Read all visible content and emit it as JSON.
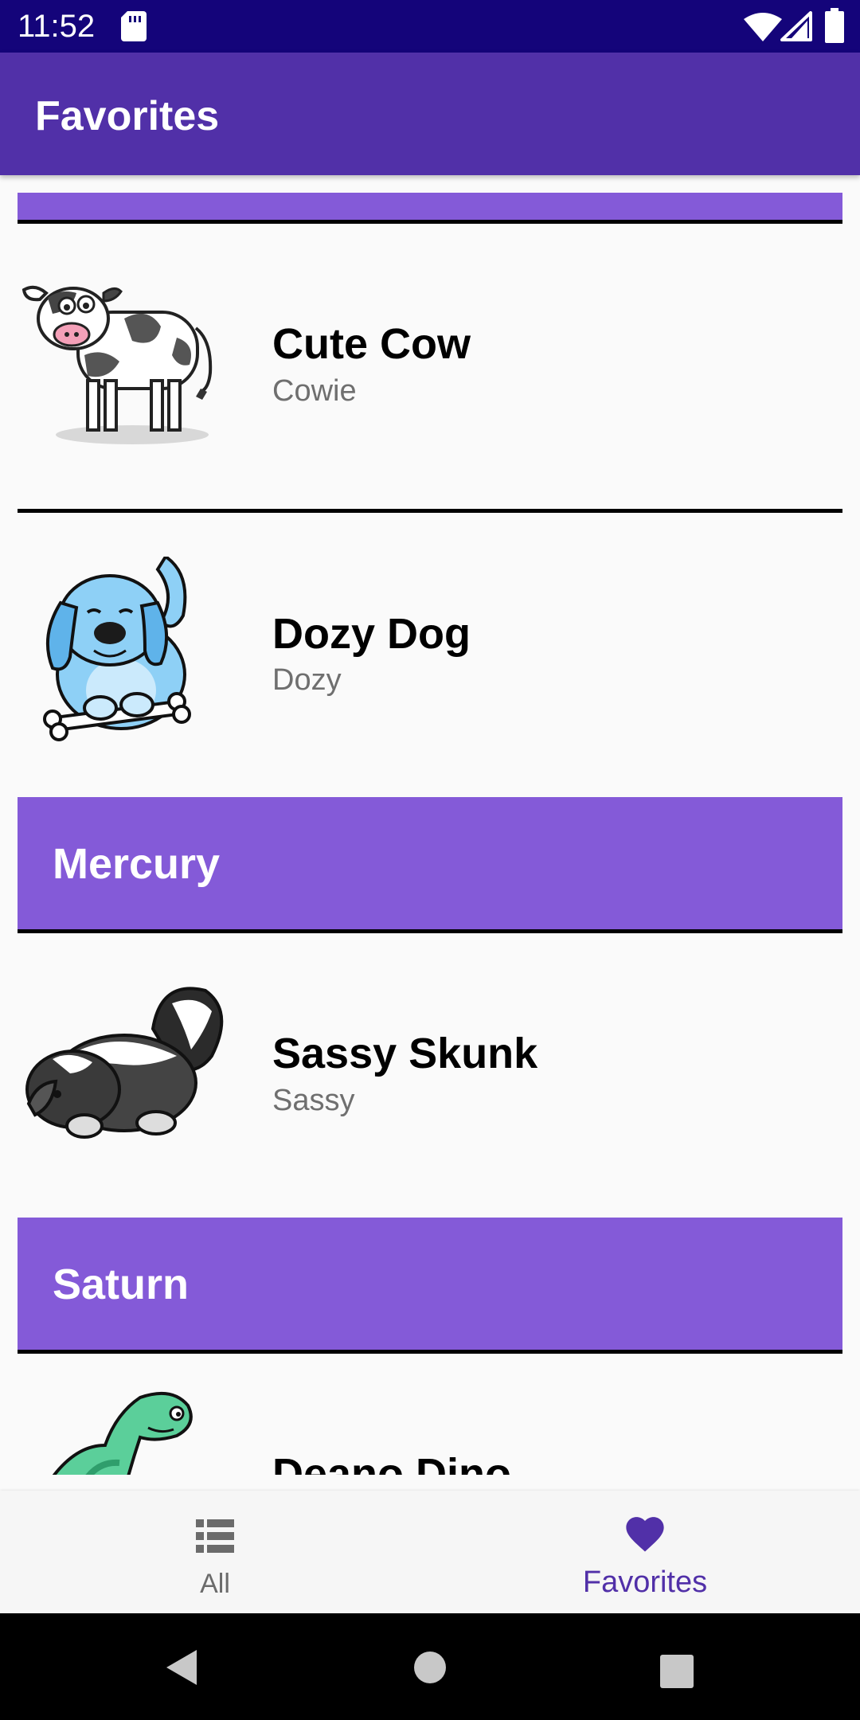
{
  "status_bar": {
    "time": "11:52"
  },
  "app_bar": {
    "title": "Favorites"
  },
  "list": {
    "items": [
      {
        "name": "Cute Cow",
        "nickname": "Cowie",
        "icon": "cow-icon"
      },
      {
        "name": "Dozy Dog",
        "nickname": "Dozy",
        "icon": "dog-icon"
      },
      {
        "name": "Sassy Skunk",
        "nickname": "Sassy",
        "icon": "skunk-icon"
      },
      {
        "name": "Deano Dino",
        "nickname": "",
        "icon": "dino-icon"
      }
    ],
    "headers": [
      {
        "label": "Mercury"
      },
      {
        "label": "Saturn"
      }
    ]
  },
  "bottom_nav": {
    "tabs": [
      {
        "label": "All",
        "icon": "list-icon",
        "selected": false
      },
      {
        "label": "Favorites",
        "icon": "heart-icon",
        "selected": true
      }
    ]
  },
  "colors": {
    "status_bar": "#14047a",
    "app_bar": "#5130a8",
    "header_band": "#845ad8",
    "selected_tab": "#5130a8",
    "unselected_tab": "#6b6b6b"
  }
}
